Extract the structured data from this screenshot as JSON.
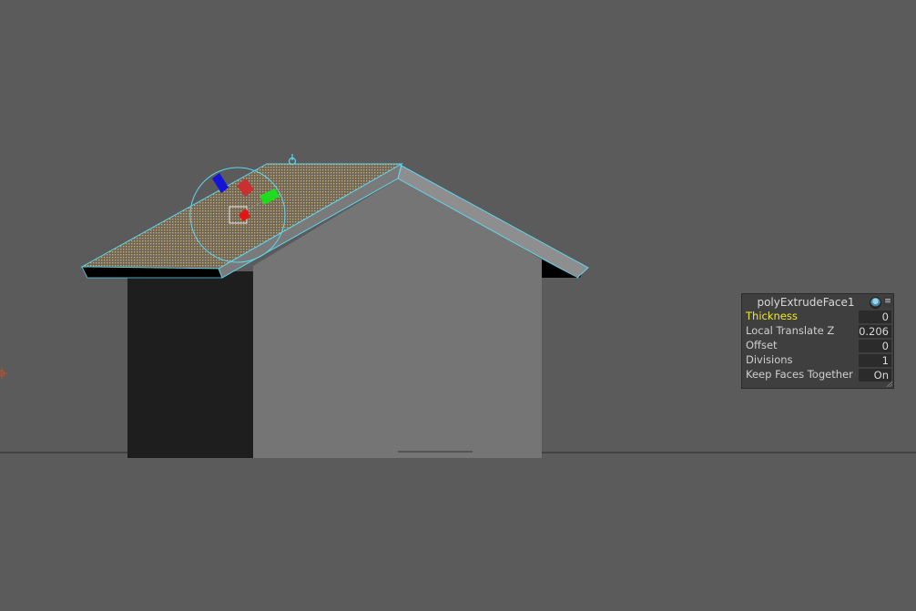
{
  "hud": {
    "title": "polyExtrudeFace1",
    "menu_icon": "menu-lines-icon",
    "attributes": [
      {
        "label": "Thickness",
        "value": "0",
        "active": true
      },
      {
        "label": "Local Translate Z",
        "value": "0.206",
        "active": false
      },
      {
        "label": "Offset",
        "value": "0",
        "active": false
      },
      {
        "label": "Divisions",
        "value": "1",
        "active": false
      },
      {
        "label": "Keep Faces Together",
        "value": "On",
        "active": false
      }
    ]
  },
  "colors": {
    "background": "#5b5b5b",
    "selection_wire": "#5fd6ee",
    "house_front": "#757575",
    "house_side": "#1e1e1e",
    "manipulator_x": "#e61414",
    "manipulator_y": "#1edd1e",
    "manipulator_z": "#1414d8"
  }
}
